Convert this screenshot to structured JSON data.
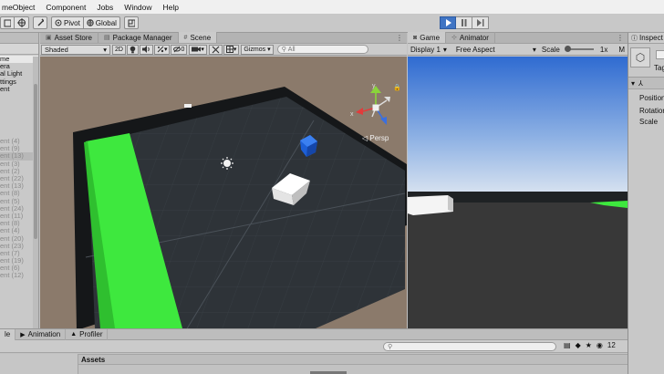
{
  "menubar": {
    "items": [
      "meObject",
      "Component",
      "Jobs",
      "Window",
      "Help"
    ]
  },
  "toolbar": {
    "pivot_label": "Pivot",
    "global_label": "Global",
    "play_icon": "play-icon",
    "pause_icon": "pause-icon",
    "step_icon": "step-icon"
  },
  "hierarchy": {
    "root_label": "me",
    "items": [
      {
        "label": "era",
        "dim": false
      },
      {
        "label": "al Light",
        "dim": false
      },
      {
        "label": "ttings",
        "dim": false
      },
      {
        "label": "ent",
        "dim": false
      },
      {
        "label": "",
        "dim": true
      },
      {
        "label": "",
        "dim": true
      },
      {
        "label": "",
        "dim": true
      },
      {
        "label": "",
        "dim": true
      },
      {
        "label": "",
        "dim": true
      },
      {
        "label": "",
        "dim": true
      },
      {
        "label": "ent (4)",
        "dim": true
      },
      {
        "label": "ent (9)",
        "dim": true
      },
      {
        "label": "ent (13)",
        "dim": true,
        "selected": true
      },
      {
        "label": "ent (3)",
        "dim": true
      },
      {
        "label": "ent (2)",
        "dim": true
      },
      {
        "label": "ent (22)",
        "dim": true
      },
      {
        "label": "ent (13)",
        "dim": true
      },
      {
        "label": "ent (8)",
        "dim": true
      },
      {
        "label": "ent (5)",
        "dim": true
      },
      {
        "label": "ent (24)",
        "dim": true
      },
      {
        "label": "ent (11)",
        "dim": true
      },
      {
        "label": "ent (8)",
        "dim": true
      },
      {
        "label": "ent (4)",
        "dim": true
      },
      {
        "label": "ent (20)",
        "dim": true
      },
      {
        "label": "ent (23)",
        "dim": true
      },
      {
        "label": "ent (7)",
        "dim": true
      },
      {
        "label": "ent (19)",
        "dim": true
      },
      {
        "label": "ent (6)",
        "dim": true
      },
      {
        "label": "ent (12)",
        "dim": true
      }
    ]
  },
  "scene": {
    "tabs": [
      {
        "label": "Asset Store",
        "icon": "store-icon"
      },
      {
        "label": "Package Manager",
        "icon": "package-icon"
      },
      {
        "label": "Scene",
        "icon": "scene-icon",
        "active": true
      }
    ],
    "shading_mode": "Shaded",
    "mode_2d": "2D",
    "hidden_count": "0",
    "gizmos_label": "Gizmos",
    "search_placeholder": "All",
    "gizmo_y": "y",
    "gizmo_x": "x",
    "persp_label": "Persp",
    "colors": {
      "floor": "#2e3338",
      "wall": "#141618",
      "green": "#3ee83e",
      "background": "#8b7a6b",
      "blue_cube": "#1d5fd6"
    }
  },
  "game": {
    "tabs": [
      {
        "label": "Game",
        "icon": "game-icon",
        "active": true
      },
      {
        "label": "Animator",
        "icon": "animator-icon"
      }
    ],
    "display_label": "Display 1",
    "aspect_label": "Free Aspect",
    "scale_label": "Scale",
    "scale_value": "1x",
    "maximize_label": "M",
    "colors": {
      "sky_top": "#2f6bd1",
      "sky_horizon": "#c5d6ee",
      "ground": "#383838"
    }
  },
  "inspector": {
    "tab_label": "Inspect",
    "tag_label": "Tag",
    "position_label": "Position",
    "rotation_label": "Rotation",
    "scale_label": "Scale"
  },
  "bottom": {
    "tabs": [
      {
        "label": "le",
        "icon": "project-icon",
        "active": true
      },
      {
        "label": "Animation",
        "icon": "animation-icon"
      },
      {
        "label": "Profiler",
        "icon": "profiler-icon"
      }
    ],
    "search_placeholder": "",
    "count_label": "12",
    "assets_label": "Assets"
  }
}
